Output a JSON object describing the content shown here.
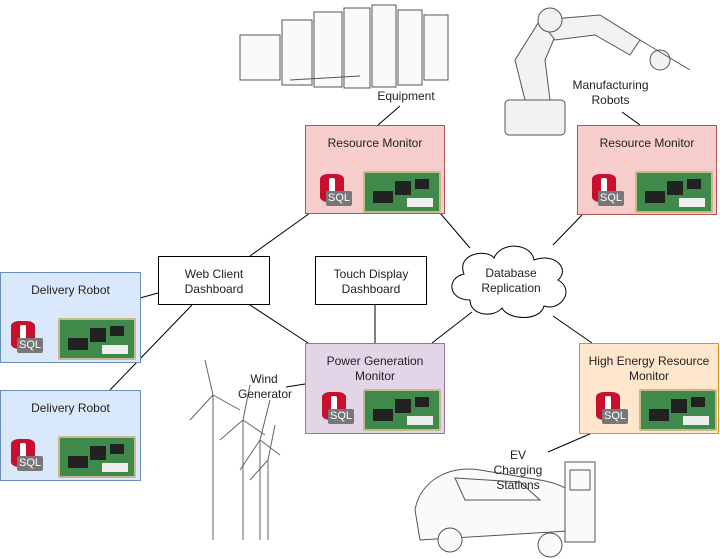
{
  "nodes": {
    "resource_monitor_1": {
      "title": "Resource Monitor",
      "sql": "SQL"
    },
    "resource_monitor_2": {
      "title": "Resource Monitor",
      "sql": "SQL"
    },
    "delivery_robot_1": {
      "title": "Delivery Robot",
      "sql": "SQL"
    },
    "delivery_robot_2": {
      "title": "Delivery Robot",
      "sql": "SQL"
    },
    "web_client": {
      "title": "Web Client Dashboard"
    },
    "touch_display": {
      "title": "Touch Display Dashboard"
    },
    "database": {
      "title": "Database Replication"
    },
    "power_generation": {
      "title": "Power Generation Monitor",
      "sql": "SQL"
    },
    "high_energy": {
      "title": "High Energy Resource Monitor",
      "sql": "SQL"
    }
  },
  "labels": {
    "equipment": "Equipment",
    "manufacturing_robots": "Manufacturing Robots",
    "wind_generator": "Wind Generator",
    "ev_charging": "EV Charging Stations"
  },
  "colors": {
    "resource": "#f8cecc",
    "client": "#dae8fc",
    "power": "#e1d5e7",
    "high_energy": "#ffe6cc"
  }
}
